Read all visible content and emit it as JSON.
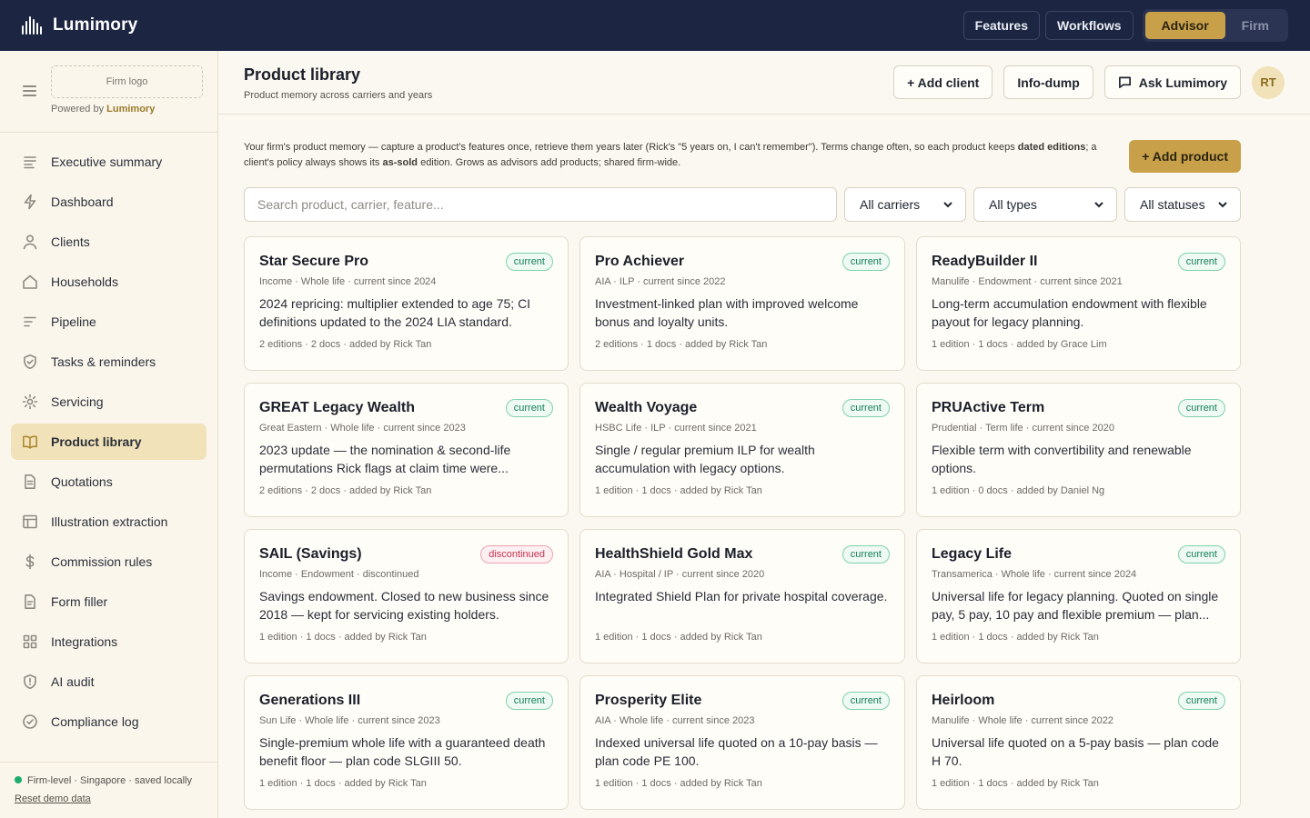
{
  "app": {
    "name": "Lumimory"
  },
  "topnav": {
    "features": "Features",
    "workflows": "Workflows",
    "advisor": "Advisor",
    "firm": "Firm",
    "active_mode": "Advisor"
  },
  "sidebar": {
    "firm_logo": "Firm logo",
    "powered_prefix": "Powered by",
    "powered_brand": "Lumimory",
    "items": [
      {
        "label": "Executive summary",
        "icon": "align-left-icon"
      },
      {
        "label": "Dashboard",
        "icon": "bolt-icon"
      },
      {
        "label": "Clients",
        "icon": "user-icon"
      },
      {
        "label": "Households",
        "icon": "home-icon"
      },
      {
        "label": "Pipeline",
        "icon": "pipeline-icon"
      },
      {
        "label": "Tasks & reminders",
        "icon": "shield-check-icon"
      },
      {
        "label": "Servicing",
        "icon": "gear-icon"
      },
      {
        "label": "Product library",
        "icon": "book-icon",
        "active": true
      },
      {
        "label": "Quotations",
        "icon": "document-icon"
      },
      {
        "label": "Illustration extraction",
        "icon": "layout-icon"
      },
      {
        "label": "Commission rules",
        "icon": "currency-icon"
      },
      {
        "label": "Form filler",
        "icon": "form-icon"
      },
      {
        "label": "Integrations",
        "icon": "grid-icon"
      },
      {
        "label": "AI audit",
        "icon": "shield-alert-icon"
      },
      {
        "label": "Compliance log",
        "icon": "check-circle-icon"
      }
    ],
    "footer_status": "Firm-level · Singapore · saved locally",
    "reset_link": "Reset demo data",
    "status_color": "#1eae6c"
  },
  "header": {
    "title": "Product library",
    "subtitle": "Product memory across carriers and years",
    "add_client": "+ Add client",
    "info_dump": "Info-dump",
    "ask": "Ask Lumimory",
    "avatar_initials": "RT"
  },
  "intro": {
    "part1": "Your firm's product memory — capture a product's features once, retrieve them years later (Rick's \"5 years on, I can't remember\"). Terms change often, so each product keeps ",
    "bold1": "dated editions",
    "part2": "; a client's policy always shows its ",
    "bold2": "as-sold",
    "part3": " edition. Grows as advisors add products; shared firm-wide."
  },
  "add_product": "+ Add product",
  "filters": {
    "search_placeholder": "Search product, carrier, feature...",
    "carriers": "All carriers",
    "types": "All types",
    "statuses": "All statuses"
  },
  "colors": {
    "accent": "#c8a04a",
    "navy": "#1c2642",
    "current": "#17805a",
    "discontinued": "#c8324f"
  },
  "products": [
    {
      "name": "Star Secure Pro",
      "status": "current",
      "meta": "Income · Whole life · current since 2024",
      "desc": "2024 repricing: multiplier extended to age 75; CI definitions updated to the 2024 LIA standard.",
      "foot": "2 editions · 2 docs · added by Rick Tan"
    },
    {
      "name": "Pro Achiever",
      "status": "current",
      "meta": "AIA · ILP · current since 2022",
      "desc": "Investment-linked plan with improved welcome bonus and loyalty units.",
      "foot": "2 editions · 1 docs · added by Rick Tan"
    },
    {
      "name": "ReadyBuilder II",
      "status": "current",
      "meta": "Manulife · Endowment · current since 2021",
      "desc": "Long-term accumulation endowment with flexible payout for legacy planning.",
      "foot": "1 edition · 1 docs · added by Grace Lim"
    },
    {
      "name": "GREAT Legacy Wealth",
      "status": "current",
      "meta": "Great Eastern · Whole life · current since 2023",
      "desc": "2023 update — the nomination & second-life permutations Rick flags at claim time were...",
      "foot": "2 editions · 2 docs · added by Rick Tan"
    },
    {
      "name": "Wealth Voyage",
      "status": "current",
      "meta": "HSBC Life · ILP · current since 2021",
      "desc": "Single / regular premium ILP for wealth accumulation with legacy options.",
      "foot": "1 edition · 1 docs · added by Rick Tan"
    },
    {
      "name": "PRUActive Term",
      "status": "current",
      "meta": "Prudential · Term life · current since 2020",
      "desc": "Flexible term with convertibility and renewable options.",
      "foot": "1 edition · 0 docs · added by Daniel Ng"
    },
    {
      "name": "SAIL (Savings)",
      "status": "discontinued",
      "meta": "Income · Endowment · discontinued",
      "desc": "Savings endowment. Closed to new business since 2018 — kept for servicing existing holders.",
      "foot": "1 edition · 1 docs · added by Rick Tan"
    },
    {
      "name": "HealthShield Gold Max",
      "status": "current",
      "meta": "AIA · Hospital / IP · current since 2020",
      "desc": "Integrated Shield Plan for private hospital coverage.",
      "foot": "1 edition · 1 docs · added by Rick Tan"
    },
    {
      "name": "Legacy Life",
      "status": "current",
      "meta": "Transamerica · Whole life · current since 2024",
      "desc": "Universal life for legacy planning. Quoted on single pay, 5 pay, 10 pay and flexible premium — plan...",
      "foot": "1 edition · 1 docs · added by Rick Tan"
    },
    {
      "name": "Generations III",
      "status": "current",
      "meta": "Sun Life · Whole life · current since 2023",
      "desc": "Single-premium whole life with a guaranteed death benefit floor — plan code SLGIII 50.",
      "foot": "1 edition · 1 docs · added by Rick Tan"
    },
    {
      "name": "Prosperity Elite",
      "status": "current",
      "meta": "AIA · Whole life · current since 2023",
      "desc": "Indexed universal life quoted on a 10-pay basis — plan code PE 100.",
      "foot": "1 edition · 1 docs · added by Rick Tan"
    },
    {
      "name": "Heirloom",
      "status": "current",
      "meta": "Manulife · Whole life · current since 2022",
      "desc": "Universal life quoted on a 5-pay basis — plan code H 70.",
      "foot": "1 edition · 1 docs · added by Rick Tan"
    }
  ]
}
